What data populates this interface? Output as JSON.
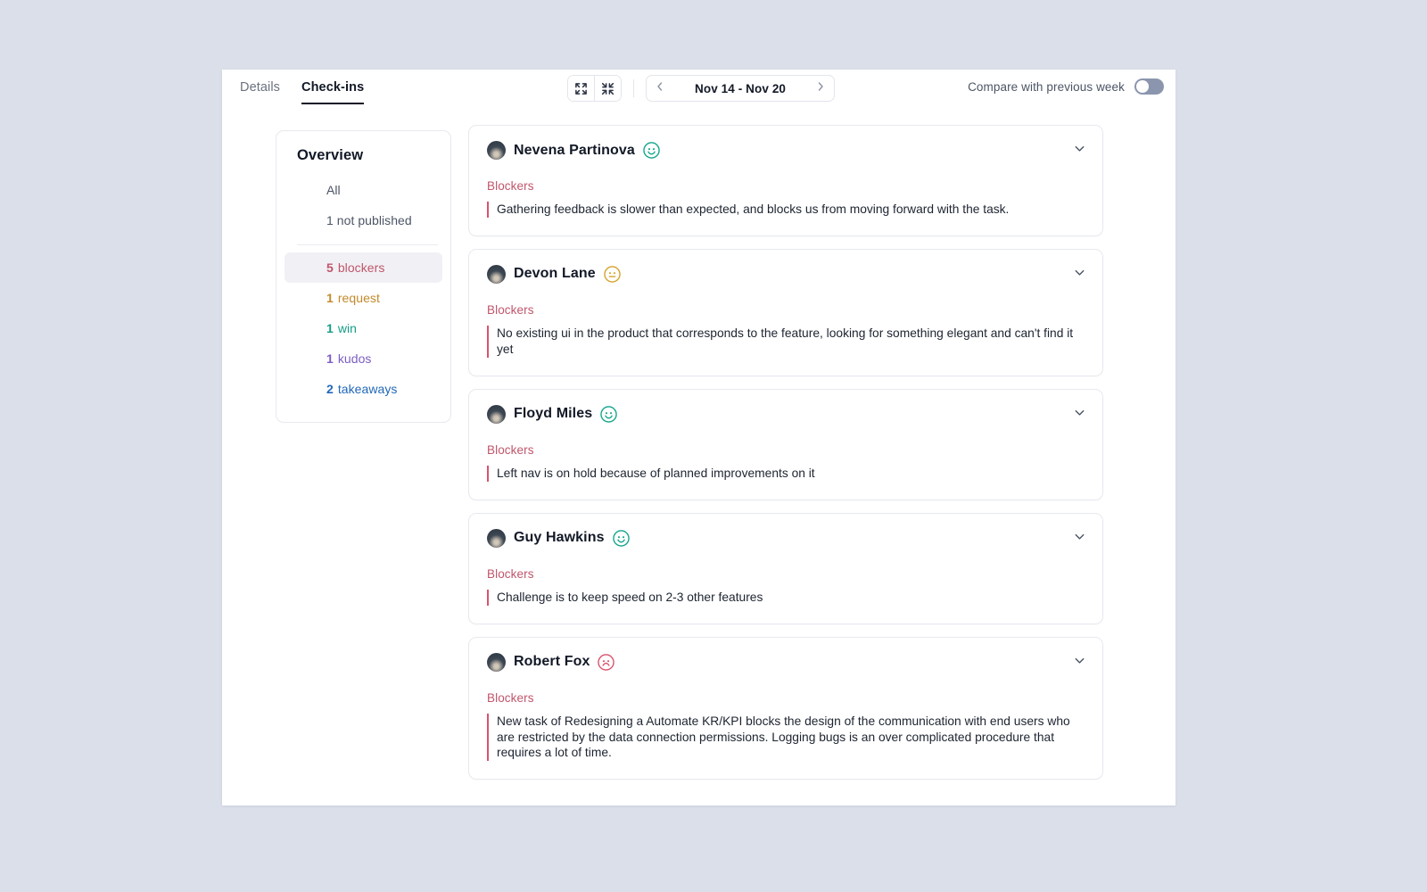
{
  "theme": {
    "page_bg": "#dadfe9",
    "panel_bg": "#ffffff",
    "accent_blocker": "#c0556b",
    "accent_request": "#c38a2a",
    "accent_win": "#159e87",
    "accent_kudos": "#7b5ec0",
    "accent_takeaways": "#2268b8",
    "toggle_track": "#8b96ae"
  },
  "topbar": {
    "tabs": [
      {
        "label": "Details",
        "active": false
      },
      {
        "label": "Check-ins",
        "active": true
      }
    ],
    "expand_all_icon": "expand-icon",
    "collapse_all_icon": "collapse-icon",
    "prev_icon": "chevron-left-icon",
    "next_icon": "chevron-right-icon",
    "date_range": "Nov 14 - Nov 20",
    "compare_label": "Compare with previous week",
    "compare_toggle_state": "off"
  },
  "overview": {
    "title": "Overview",
    "items": [
      {
        "count": "",
        "label": "All",
        "color": "#4c5565",
        "active": false
      },
      {
        "count": "",
        "label": "1 not published",
        "color": "#4c5565",
        "active": false
      },
      {
        "count": "5",
        "label": "blockers",
        "color": "#c0556b",
        "active": true
      },
      {
        "count": "1",
        "label": "request",
        "color": "#c38a2a",
        "active": false
      },
      {
        "count": "1",
        "label": "win",
        "color": "#159e87",
        "active": false
      },
      {
        "count": "1",
        "label": "kudos",
        "color": "#7b5ec0",
        "active": false
      },
      {
        "count": "2",
        "label": "takeaways",
        "color": "#2268b8",
        "active": false
      }
    ]
  },
  "checkins": [
    {
      "name": "Nevena Partinova",
      "mood": "happy-face-icon",
      "mood_color": "#12a58c",
      "section": "Blockers",
      "section_color": "#c0556b",
      "text": "Gathering feedback is slower than expected, and blocks us from moving forward with the task.",
      "chevron": "chevron-down-icon"
    },
    {
      "name": "Devon Lane",
      "mood": "neutral-face-icon",
      "mood_color": "#d5a32b",
      "section": "Blockers",
      "section_color": "#c0556b",
      "text": "No existing ui in the product that corresponds to the feature, looking for something elegant and can't find it yet",
      "chevron": "chevron-down-icon"
    },
    {
      "name": "Floyd Miles",
      "mood": "happy-face-icon",
      "mood_color": "#12a58c",
      "section": "Blockers",
      "section_color": "#c0556b",
      "text": "Left nav is on hold because of planned improvements on it",
      "chevron": "chevron-down-icon"
    },
    {
      "name": "Guy Hawkins",
      "mood": "happy-face-icon",
      "mood_color": "#12a58c",
      "section": "Blockers",
      "section_color": "#c0556b",
      "text": "Challenge is to keep speed on 2-3 other features",
      "chevron": "chevron-down-icon"
    },
    {
      "name": "Robert Fox",
      "mood": "sad-face-icon",
      "mood_color": "#d9526d",
      "section": "Blockers",
      "section_color": "#c0556b",
      "text": "New task of Redesigning a Automate KR/KPI blocks the design of the communication with end users who are restricted by the data connection permissions. Logging bugs is an over complicated procedure that requires a lot of time.",
      "chevron": "chevron-down-icon"
    }
  ]
}
